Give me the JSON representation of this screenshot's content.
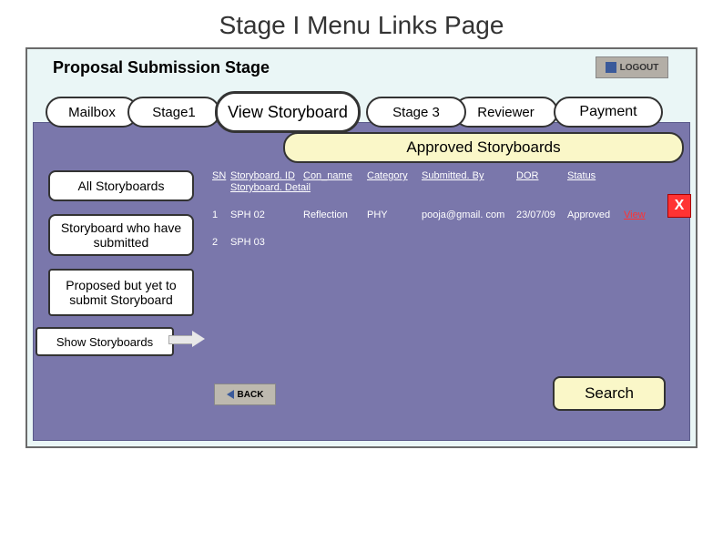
{
  "page_title": "Stage I Menu Links Page",
  "subtitle": "Proposal Submission Stage",
  "logout_label": "LOGOUT",
  "tabs": {
    "mailbox": "Mailbox",
    "stage1": "Stage1",
    "view_storyboard": "View Storyboard",
    "stage3": "Stage 3",
    "reviewer": "Reviewer",
    "payment": "Payment"
  },
  "section_header": "Approved Storyboards",
  "sidebar": {
    "all": "All Storyboards",
    "submitted": "Storyboard who have submitted",
    "proposed": "Proposed but yet to submit Storyboard",
    "show": "Show Storyboards"
  },
  "table": {
    "headers": {
      "sn": "SN",
      "sid": "Storyboard. ID",
      "con": "Con_name",
      "cat": "Category",
      "sub": "Submitted. By",
      "dor": "DOR",
      "status": "Status",
      "detail": "Storyboard. Detail"
    },
    "rows": [
      {
        "sn": "1",
        "sid": "SPH 02",
        "con": "Reflection",
        "cat": "PHY",
        "sub": "pooja@gmail. com",
        "dor": "23/07/09",
        "status": "Approved",
        "link": "View"
      },
      {
        "sn": "2",
        "sid": "SPH 03",
        "con": "",
        "cat": "",
        "sub": "",
        "dor": "",
        "status": "",
        "link": ""
      }
    ]
  },
  "close_label": "X",
  "back_label": "BACK",
  "search_label": "Search"
}
